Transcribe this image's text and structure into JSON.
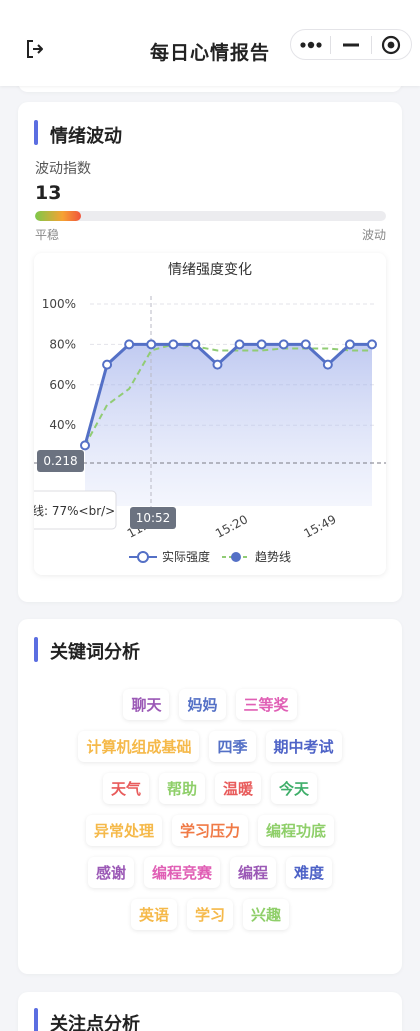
{
  "nav": {
    "title": "每日心情报告"
  },
  "wave": {
    "title": "情绪波动",
    "index_label": "波动指数",
    "index_value": "13",
    "index_fraction": 0.13,
    "min_label": "平稳",
    "max_label": "波动"
  },
  "chart_data": {
    "type": "line",
    "title": "情绪强度变化",
    "x_ticks": [
      "10:52",
      "11:16",
      "15:20",
      "15:49"
    ],
    "y_ticks": [
      "100%",
      "80%",
      "60%",
      "40%"
    ],
    "ylim": [
      0,
      100
    ],
    "series": [
      {
        "name": "实际强度",
        "values": [
          30,
          70,
          80,
          80,
          80,
          80,
          70,
          80,
          80,
          80,
          80,
          70,
          80,
          80
        ],
        "color": "#5470c6"
      },
      {
        "name": "趋势线",
        "values": [
          30,
          50,
          58,
          77,
          80,
          79,
          77,
          77,
          77,
          78,
          78,
          78,
          77,
          77
        ],
        "color": "#91cc75"
      }
    ],
    "tooltip": {
      "y_value": "0.218",
      "x_value": "10:52",
      "text": "线: 77%<br/>",
      "partial_x_label": "10:"
    },
    "grid": true,
    "legend": "bottom-center"
  },
  "keywords": {
    "title": "关键词分析",
    "rows": [
      [
        {
          "text": "聊天",
          "color": "#9b59b6"
        },
        {
          "text": "妈妈",
          "color": "#5470c6"
        },
        {
          "text": "三等奖",
          "color": "#e05fb5"
        }
      ],
      [
        {
          "text": "计算机组成基础",
          "color": "#f5b94a"
        },
        {
          "text": "四季",
          "color": "#5470c6"
        },
        {
          "text": "期中考试",
          "color": "#4e63c7"
        }
      ],
      [
        {
          "text": "天气",
          "color": "#e85b5b"
        },
        {
          "text": "帮助",
          "color": "#8fcf6a"
        },
        {
          "text": "温暖",
          "color": "#e85b5b"
        },
        {
          "text": "今天",
          "color": "#3fae6a"
        }
      ],
      [
        {
          "text": "异常处理",
          "color": "#f5b94a"
        },
        {
          "text": "学习压力",
          "color": "#f07a46"
        },
        {
          "text": "编程功底",
          "color": "#8fcf6a"
        }
      ],
      [
        {
          "text": "感谢",
          "color": "#9b59b6"
        },
        {
          "text": "编程竞赛",
          "color": "#e05fb5"
        },
        {
          "text": "编程",
          "color": "#9b59b6"
        },
        {
          "text": "难度",
          "color": "#4e63c7"
        }
      ],
      [
        {
          "text": "英语",
          "color": "#f5b94a"
        },
        {
          "text": "学习",
          "color": "#f5b94a"
        },
        {
          "text": "兴趣",
          "color": "#8fcf6a"
        }
      ]
    ]
  },
  "focus": {
    "title": "关注点分析"
  },
  "colors": {
    "accent": "#5b6ee1"
  },
  "icons": {
    "back": "logout-icon",
    "more": "more-dots-icon",
    "minimize": "minimize-icon",
    "close": "target-close-icon"
  }
}
